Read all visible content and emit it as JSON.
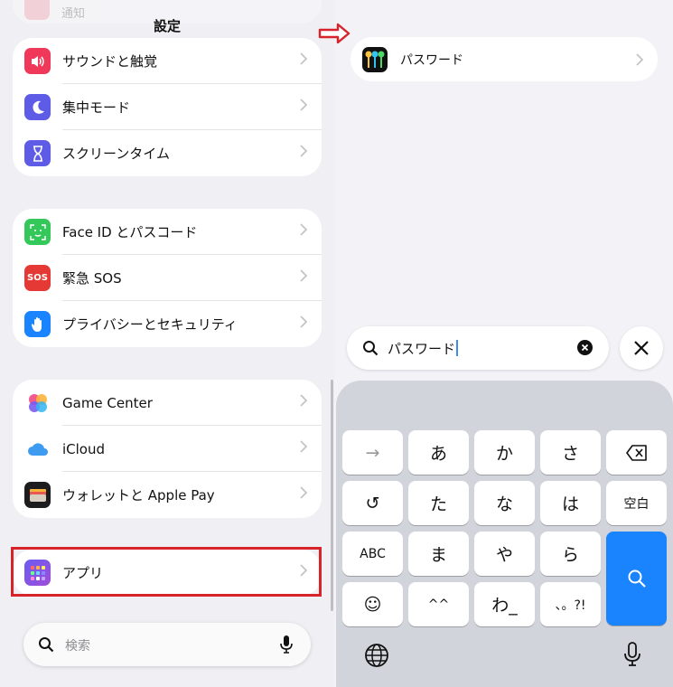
{
  "left": {
    "nav_title": "設定",
    "faded_item": "通知",
    "group1": [
      {
        "label": "サウンドと触覚",
        "icon": "speaker-icon",
        "color": "#f0385a"
      },
      {
        "label": "集中モード",
        "icon": "moon-icon",
        "color": "#5e5ce6"
      },
      {
        "label": "スクリーンタイム",
        "icon": "hourglass-icon",
        "color": "#5e5ce6"
      }
    ],
    "group2": [
      {
        "label": "Face ID とパスコード",
        "icon": "faceid-icon",
        "color": "#34c759"
      },
      {
        "label": "緊急 SOS",
        "icon": "sos-icon",
        "color": "#e53935",
        "icon_text": "SOS"
      },
      {
        "label": "プライバシーとセキュリティ",
        "icon": "hand-icon",
        "color": "#1a84ff"
      }
    ],
    "group3": [
      {
        "label": "Game Center",
        "icon": "game-center-icon"
      },
      {
        "label": "iCloud",
        "icon": "cloud-icon"
      },
      {
        "label": "ウォレットと Apple Pay",
        "icon": "wallet-icon"
      }
    ],
    "group4": [
      {
        "label": "アプリ",
        "icon": "apps-grid-icon"
      }
    ],
    "search_placeholder": "検索"
  },
  "right": {
    "result_label": "パスワード",
    "search_value": "パスワード",
    "keyboard": {
      "row1": [
        "→",
        "あ",
        "か",
        "さ"
      ],
      "row2": [
        "↺",
        "た",
        "な",
        "は",
        "空白"
      ],
      "row3": [
        "ABC",
        "ま",
        "や",
        "ら"
      ],
      "row4": [
        "☺",
        "^^",
        "わ_",
        "、。?!"
      ]
    }
  },
  "colors": {
    "highlight": "#d9232b",
    "accent": "#1a84ff"
  }
}
